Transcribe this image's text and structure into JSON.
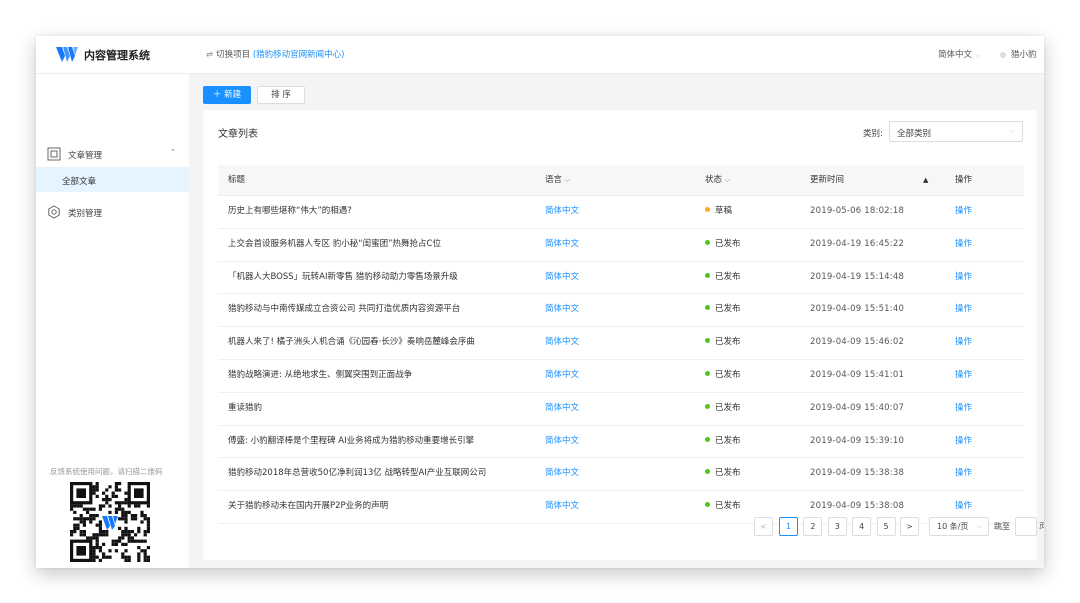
{
  "header": {
    "app_title": "内容管理系统",
    "switch_label": "切换项目",
    "project_name": "(猎豹移动官网新闻中心)",
    "language": "简体中文",
    "username": "猎小豹"
  },
  "sidebar": {
    "items": [
      {
        "label": "文章管理",
        "icon": "document-icon",
        "expanded": true
      },
      {
        "label": "类别管理",
        "icon": "gear-icon"
      }
    ],
    "sub_items": [
      {
        "label": "全部文章",
        "selected": true
      }
    ],
    "feedback": "反馈系统使用问题，请扫描二维码"
  },
  "toolbar": {
    "new_label": "新建",
    "sort_label": "排 序"
  },
  "list": {
    "title": "文章列表",
    "filter_label": "类别:",
    "filter_value": "全部类别",
    "columns": {
      "title": "标题",
      "language": "语言",
      "status": "状态",
      "updated": "更新时间",
      "action": "操作"
    },
    "rows": [
      {
        "title": "历史上有哪些堪称“伟大”的相遇?",
        "language": "简体中文",
        "status": "草稿",
        "status_color": "#faad14",
        "updated": "2019-05-06 18:02:18",
        "action": "操作"
      },
      {
        "title": "上交会首设服务机器人专区 豹小秘“闺蜜团”热舞抢占C位",
        "language": "简体中文",
        "status": "已发布",
        "status_color": "#52c41a",
        "updated": "2019-04-19 16:45:22",
        "action": "操作"
      },
      {
        "title": "「机器人大BOSS」玩转AI新零售 猎豹移动助力零售场景升级",
        "language": "简体中文",
        "status": "已发布",
        "status_color": "#52c41a",
        "updated": "2019-04-19 15:14:48",
        "action": "操作"
      },
      {
        "title": "猎豹移动与中南传媒成立合资公司 共同打造优质内容资源平台",
        "language": "简体中文",
        "status": "已发布",
        "status_color": "#52c41a",
        "updated": "2019-04-09 15:51:40",
        "action": "操作"
      },
      {
        "title": "机器人来了! 橘子洲头人机合诵《沁园春·长沙》奏响岳麓峰会序曲",
        "language": "简体中文",
        "status": "已发布",
        "status_color": "#52c41a",
        "updated": "2019-04-09 15:46:02",
        "action": "操作"
      },
      {
        "title": "猎豹战略演进: 从绝地求生、侧翼突围到正面战争",
        "language": "简体中文",
        "status": "已发布",
        "status_color": "#52c41a",
        "updated": "2019-04-09 15:41:01",
        "action": "操作"
      },
      {
        "title": "重读猎豹",
        "language": "简体中文",
        "status": "已发布",
        "status_color": "#52c41a",
        "updated": "2019-04-09 15:40:07",
        "action": "操作"
      },
      {
        "title": "傅盛: 小豹翻译棒是个里程碑 AI业务将成为猎豹移动重要增长引擎",
        "language": "简体中文",
        "status": "已发布",
        "status_color": "#52c41a",
        "updated": "2019-04-09 15:39:10",
        "action": "操作"
      },
      {
        "title": "猎豹移动2018年总营收50亿净利润13亿 战略转型AI产业互联网公司",
        "language": "简体中文",
        "status": "已发布",
        "status_color": "#52c41a",
        "updated": "2019-04-09 15:38:38",
        "action": "操作"
      },
      {
        "title": "关于猎豹移动未在国内开展P2P业务的声明",
        "language": "简体中文",
        "status": "已发布",
        "status_color": "#52c41a",
        "updated": "2019-04-09 15:38:08",
        "action": "操作"
      }
    ]
  },
  "pagination": {
    "prev": "<",
    "next": ">",
    "pages": [
      "1",
      "2",
      "3",
      "4",
      "5"
    ],
    "current": "1",
    "page_size": "10 条/页",
    "jump_label": "跳至",
    "page_suffix": "页"
  },
  "colors": {
    "primary": "#1890ff",
    "draft": "#faad14",
    "published": "#52c41a"
  }
}
